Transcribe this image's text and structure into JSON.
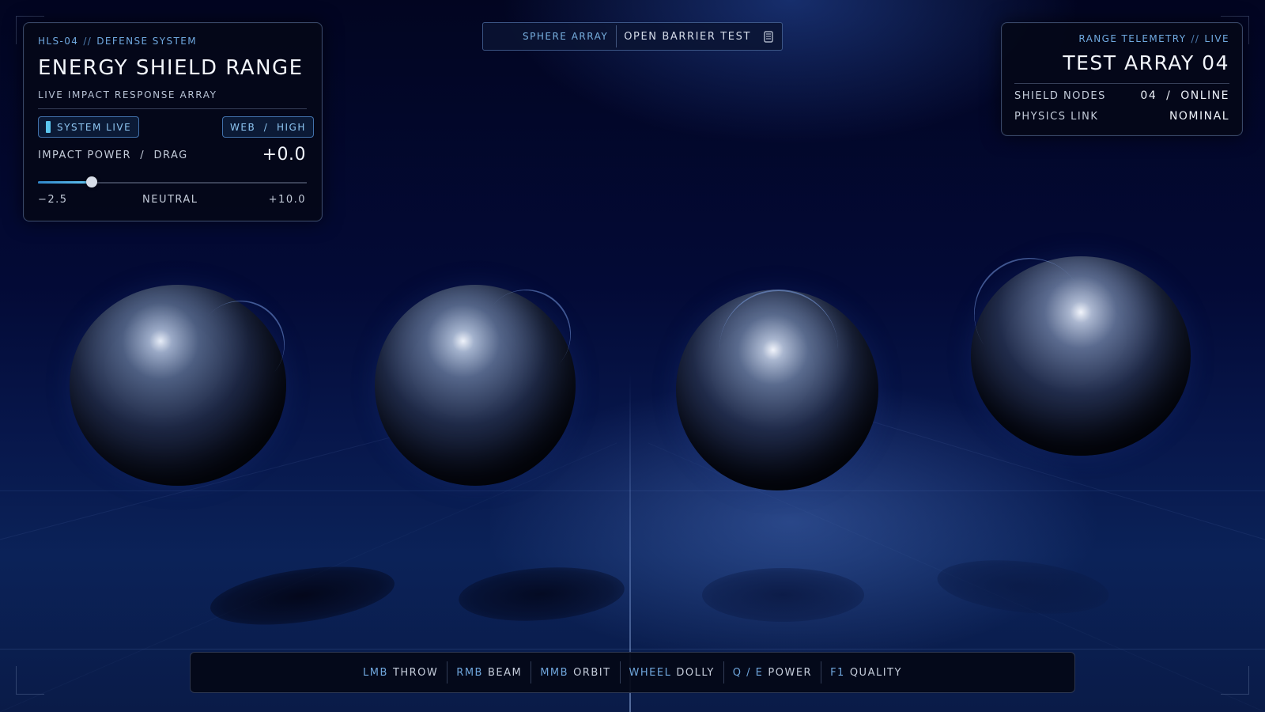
{
  "header": {
    "system_code": "HLS-04",
    "separator": "//",
    "system_name": "DEFENSE SYSTEM",
    "title": "ENERGY SHIELD RANGE",
    "subtitle": "LIVE IMPACT RESPONSE ARRAY"
  },
  "badges": {
    "system_live": "SYSTEM LIVE",
    "quality": "WEB  /  HIGH"
  },
  "impact": {
    "label": "IMPACT POWER  /  DRAG",
    "value": "+0.0",
    "min_label": "−2.5",
    "mid_label": "NEUTRAL",
    "max_label": "+10.0",
    "slider_fraction": 0.2
  },
  "topbar": {
    "mode": "SPHERE ARRAY",
    "action": "OPEN BARRIER TEST",
    "action_icon": "beaker-icon"
  },
  "telemetry": {
    "kicker": "RANGE TELEMETRY",
    "separator": "//",
    "status": "LIVE",
    "title": "TEST ARRAY 04",
    "rows": [
      {
        "label": "SHIELD NODES",
        "value": "04  /  ONLINE"
      },
      {
        "label": "PHYSICS LINK",
        "value": "NOMINAL"
      }
    ]
  },
  "controls": [
    {
      "key": "LMB",
      "action": "THROW"
    },
    {
      "key": "RMB",
      "action": "BEAM"
    },
    {
      "key": "MMB",
      "action": "ORBIT"
    },
    {
      "key": "WHEEL",
      "action": "DOLLY"
    },
    {
      "key": "Q / E",
      "action": "POWER"
    },
    {
      "key": "F1",
      "action": "QUALITY"
    }
  ],
  "colors": {
    "accent": "#6fa8df",
    "live": "#5cc6ee",
    "background": "#030a36"
  }
}
